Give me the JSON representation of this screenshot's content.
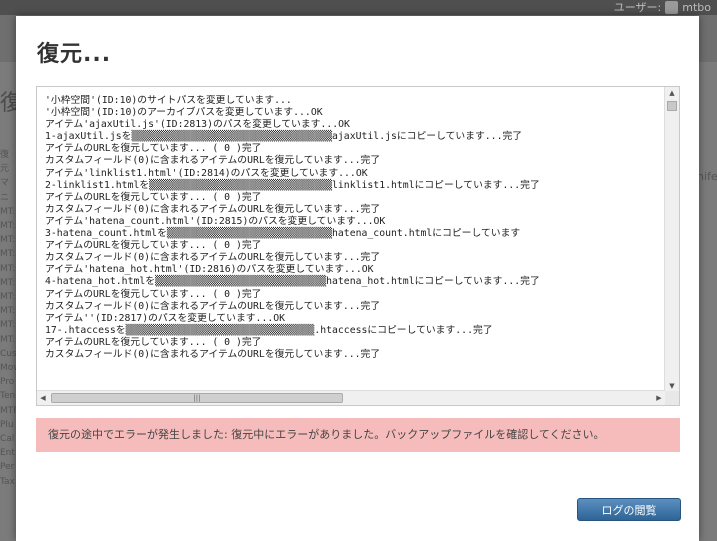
{
  "background": {
    "user_label": "ユーザー:",
    "user_name": "mtbo",
    "page_title": "復元",
    "side_items": [
      "復元",
      "マニ",
      "MT:",
      "MT:",
      "MT:",
      "MT:",
      "MT:",
      "MT:",
      "MT:",
      "MT:",
      "MT:",
      "MT:",
      "Cus",
      "Mov",
      "Pro",
      "Ten",
      "MTP",
      "Plu",
      "Cal",
      "Ent",
      "Per",
      "Tax"
    ],
    "right_text": "nife"
  },
  "dialog": {
    "title": "復元...",
    "log_lines": [
      "'小枠空間'(ID:10)のサイトパスを変更しています...",
      "'小枠空間'(ID:10)のアーカイブパスを変更しています...OK",
      "アイテム'ajaxUtil.js'(ID:2813)のパスを変更しています...OK",
      "1-ajaxUtil.jsを▒▒▒▒▒▒▒▒▒▒▒▒▒▒▒▒▒▒▒▒▒▒▒▒▒▒▒▒▒▒▒▒▒▒ajaxUtil.jsにコピーしています...完了",
      "アイテムのURLを復元しています... ( 0 )完了",
      "カスタムフィールド(0)に含まれるアイテムのURLを復元しています...完了",
      "アイテム'linklist1.html'(ID:2814)のパスを変更しています...OK",
      "2-linklist1.htmlを▒▒▒▒▒▒▒▒▒▒▒▒▒▒▒▒▒▒▒▒▒▒▒▒▒▒▒▒▒▒▒linklist1.htmlにコピーしています...完了",
      "アイテムのURLを復元しています... ( 0 )完了",
      "カスタムフィールド(0)に含まれるアイテムのURLを復元しています...完了",
      "アイテム'hatena_count.html'(ID:2815)のパスを変更しています...OK",
      "3-hatena_count.htmlを▒▒▒▒▒▒▒▒▒▒▒▒▒▒▒▒▒▒▒▒▒▒▒▒▒▒▒▒hatena_count.htmlにコピーしています",
      "アイテムのURLを復元しています... ( 0 )完了",
      "カスタムフィールド(0)に含まれるアイテムのURLを復元しています...完了",
      "アイテム'hatena_hot.html'(ID:2816)のパスを変更しています...OK",
      "4-hatena_hot.htmlを▒▒▒▒▒▒▒▒▒▒▒▒▒▒▒▒▒▒▒▒▒▒▒▒▒▒▒▒▒hatena_hot.htmlにコピーしています...完了",
      "アイテムのURLを復元しています... ( 0 )完了",
      "カスタムフィールド(0)に含まれるアイテムのURLを復元しています...完了",
      "アイテム''(ID:2817)のパスを変更しています...OK",
      "17-.htaccessを▒▒▒▒▒▒▒▒▒▒▒▒▒▒▒▒▒▒▒▒▒▒▒▒▒▒▒▒▒▒▒▒.htaccessにコピーしています...完了",
      "アイテムのURLを復元しています... ( 0 )完了",
      "カスタムフィールド(0)に含まれるアイテムのURLを復元しています...完了"
    ],
    "error_message": "復元の途中でエラーが発生しました: 復元中にエラーがありました。バックアップファイルを確認してください。",
    "log_button_label": "ログの閲覧"
  },
  "icons": {
    "scroll_up": "scroll-up-arrow-icon",
    "scroll_down": "scroll-down-arrow-icon",
    "scroll_left": "scroll-left-arrow-icon",
    "scroll_right": "scroll-right-arrow-icon",
    "grip": "scroll-grip-icon"
  },
  "colors": {
    "error_bg": "#f6bcbc",
    "button": "#2e6496"
  }
}
